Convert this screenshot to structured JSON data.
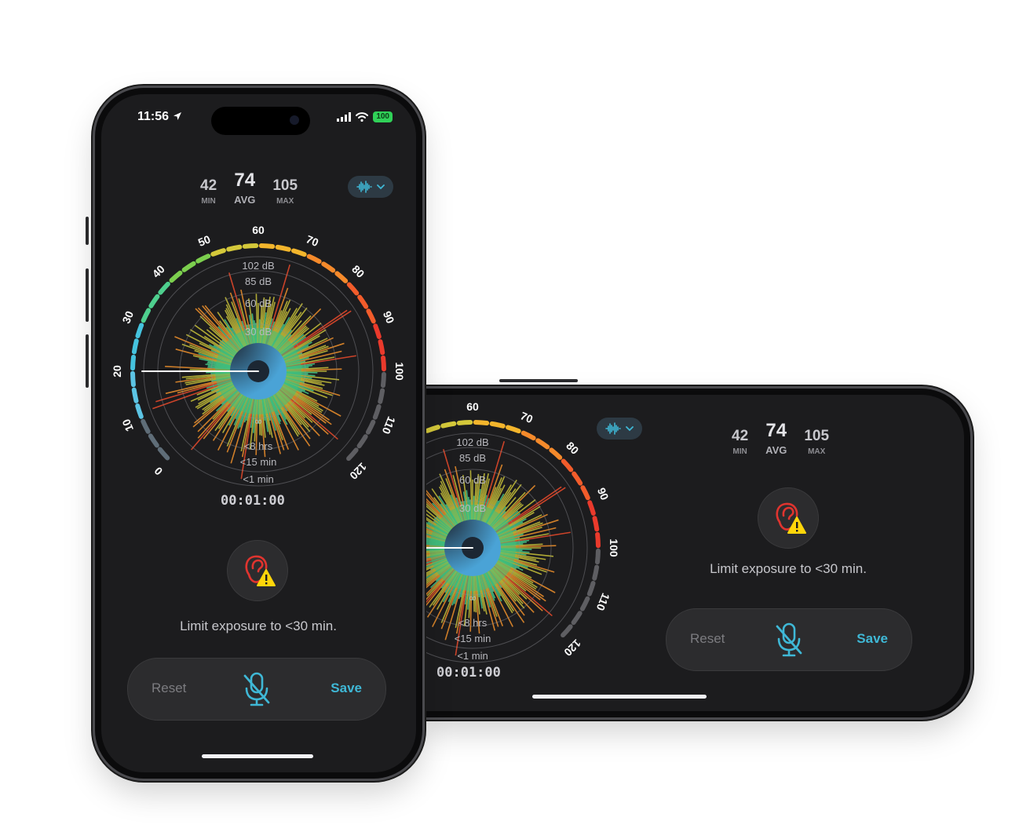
{
  "status": {
    "time": "11:56",
    "battery": "100"
  },
  "stats": {
    "min": {
      "value": "42",
      "label": "MIN"
    },
    "avg": {
      "value": "74",
      "label": "AVG"
    },
    "max": {
      "value": "105",
      "label": "MAX"
    }
  },
  "gauge": {
    "scale": [
      "0",
      "10",
      "20",
      "30",
      "40",
      "50",
      "60",
      "70",
      "80",
      "90",
      "100",
      "110",
      "120"
    ],
    "rings": [
      "102 dB",
      "85 dB",
      "60 dB",
      "30 dB"
    ],
    "durations": [
      "∞",
      "<8 hrs",
      "<15 min",
      "<1 min"
    ],
    "current_db": 20
  },
  "timer": "00:01:00",
  "warning": {
    "text": "Limit exposure to <30 min."
  },
  "controls": {
    "reset": "Reset",
    "save": "Save"
  },
  "icons": {
    "waveform": "waveform-icon",
    "chevron": "chevron-down-icon",
    "ear": "ear-warning-icon",
    "mic": "mic-off-icon",
    "location": "location-arrow-icon"
  },
  "colors": {
    "accent": "#3fb8d6",
    "warning_red": "#e0342f",
    "warning_yellow": "#ffd60a",
    "background": "#1c1c1e"
  }
}
